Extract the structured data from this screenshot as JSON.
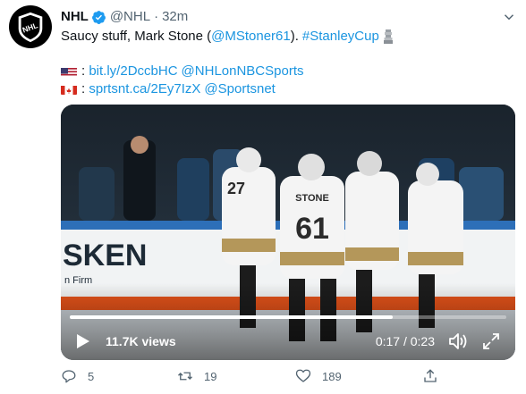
{
  "tweet": {
    "display_name": "NHL",
    "handle": "@NHL",
    "separator": "·",
    "timestamp": "32m",
    "line1_text": "Saucy stuff, Mark Stone (",
    "line1_mention": "@MStoner61",
    "line1_close": ").",
    "line1_hashtag": "#StanleyCup",
    "us_flag": "🇺🇸",
    "us_colon": ": ",
    "us_link": "bit.ly/2DccbHC",
    "us_mention": "@NHLonNBCSports",
    "ca_flag": "🇨🇦",
    "ca_colon": ": ",
    "ca_link": "sprtsnt.ca/2Ey7IzX",
    "ca_mention": "@Sportsnet"
  },
  "video": {
    "views": "11.7K views",
    "time": "0:17 / 0:23",
    "progress": 0.74,
    "scene_banner_text": "SKEN",
    "scene_banner_subtext": "n Firm",
    "player_name": "STONE",
    "player_number": "61",
    "player2_number": "27"
  },
  "actions": {
    "replies": "5",
    "retweets": "19",
    "likes": "189"
  },
  "colors": {
    "link": "#1b95e0",
    "verified": "#1d9bf0",
    "muted": "#536471"
  }
}
